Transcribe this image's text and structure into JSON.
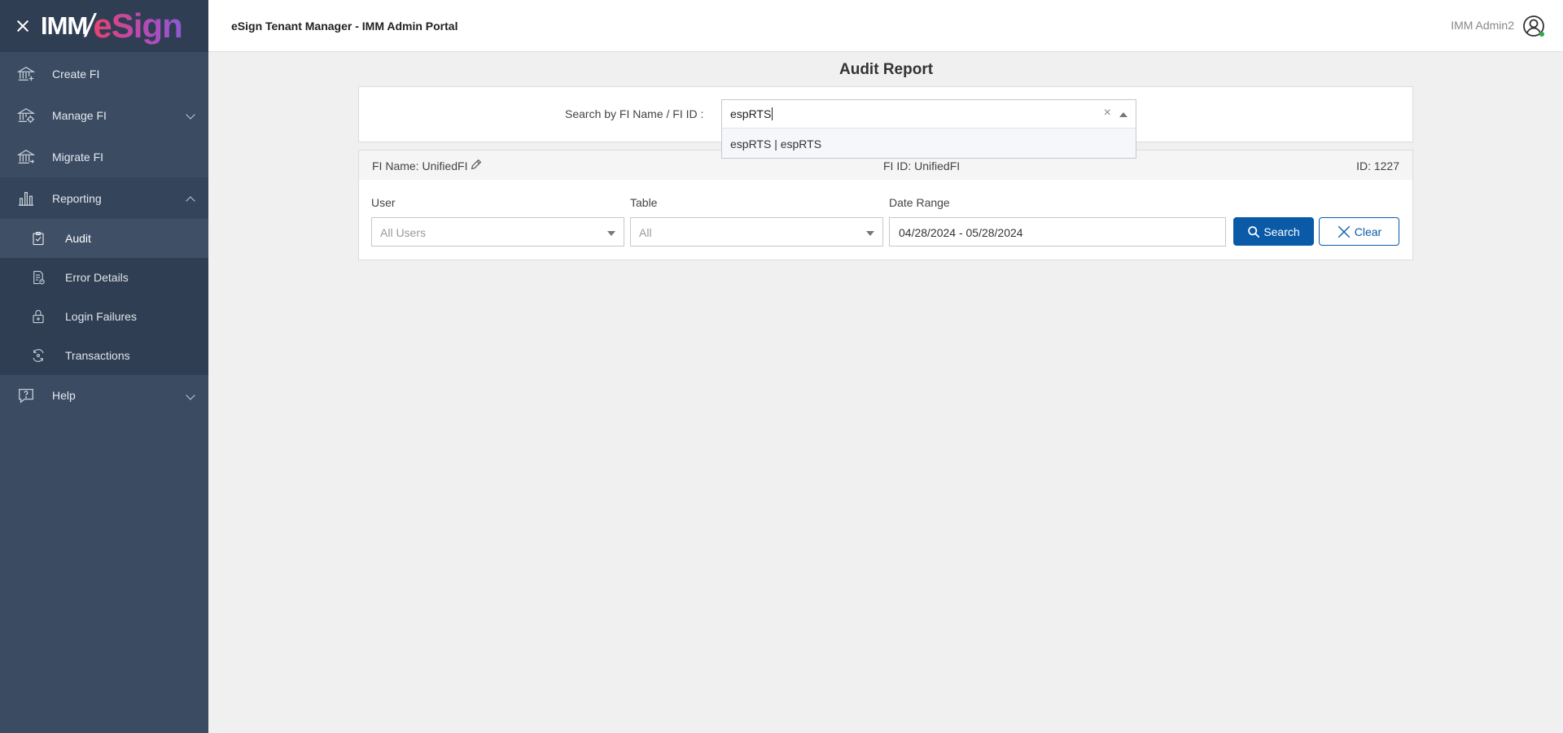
{
  "brand": {
    "logo_imm": "IMM",
    "logo_esign": "eSign"
  },
  "header": {
    "title": "eSign Tenant Manager - IMM Admin Portal",
    "user_name": "IMM Admin2"
  },
  "sidebar": {
    "items": [
      {
        "label": "Create FI",
        "icon": "bank-add-icon"
      },
      {
        "label": "Manage FI",
        "icon": "bank-settings-icon"
      },
      {
        "label": "Migrate FI",
        "icon": "bank-migrate-icon"
      },
      {
        "label": "Reporting",
        "icon": "bar-chart-icon"
      },
      {
        "label": "Help",
        "icon": "help-icon"
      }
    ],
    "reporting_sub": [
      {
        "label": "Audit",
        "icon": "clipboard-check-icon"
      },
      {
        "label": "Error Details",
        "icon": "document-error-icon"
      },
      {
        "label": "Login Failures",
        "icon": "lock-icon"
      },
      {
        "label": "Transactions",
        "icon": "refresh-icon"
      }
    ]
  },
  "main": {
    "page_title": "Audit Report",
    "search": {
      "label": "Search by FI Name / FI ID :",
      "value": "espRTS",
      "clear_symbol": "×",
      "dropdown_options": [
        "espRTS | espRTS"
      ]
    },
    "fi_info": {
      "fi_name": "FI Name: UnifiedFI",
      "fi_id": "FI ID: UnifiedFI",
      "id": "ID: 1227"
    },
    "filters": {
      "user_label": "User",
      "user_value": "All Users",
      "table_label": "Table",
      "table_value": "All",
      "date_label": "Date Range",
      "date_value": "04/28/2024 - 05/28/2024",
      "search_button": "Search",
      "clear_button": "Clear"
    }
  },
  "colors": {
    "sidebar": "#3b4b62",
    "primary": "#0a5aa8",
    "background": "#f0f0f0"
  }
}
